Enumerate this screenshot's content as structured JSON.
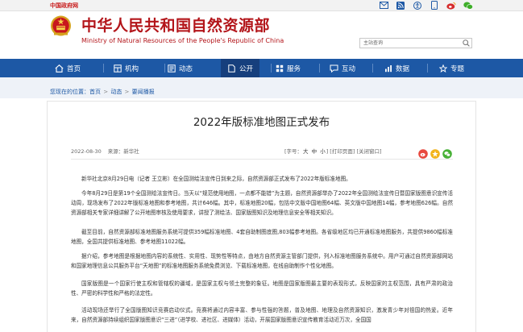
{
  "topbar": {
    "gov_link": "中国政府网"
  },
  "header": {
    "title_cn": "中华人民共和国自然资源部",
    "title_en": "Ministry of Natural Resources of the People's Republic of China",
    "search_placeholder": "主站查询"
  },
  "nav": {
    "items": [
      {
        "label": "首页",
        "icon": "home-icon"
      },
      {
        "label": "机构",
        "icon": "building-icon"
      },
      {
        "label": "动态",
        "icon": "news-icon"
      },
      {
        "label": "公开",
        "icon": "document-icon"
      },
      {
        "label": "服务",
        "icon": "service-icon"
      },
      {
        "label": "互动",
        "icon": "chat-icon"
      },
      {
        "label": "数据",
        "icon": "chart-icon"
      },
      {
        "label": "专题",
        "icon": "topic-icon"
      }
    ]
  },
  "breadcrumb": {
    "prefix": "您现在的位置：",
    "items": [
      "首页",
      "动态",
      "要闻播报"
    ]
  },
  "article": {
    "title": "2022年版标准地图正式发布",
    "date": "2022-08-30",
    "source": "来源：新华社",
    "font_label": "[字号：",
    "font_options": [
      "大",
      "中",
      "小"
    ],
    "print": "] [打印页面]",
    "close": "[关闭窗口]",
    "paragraphs": [
      "新华社北京8月29日电（记者 王立彬）在全国测绘法宣传日到来之际，自然资源部正式发布了2022年版标准地图。",
      "今年8月29日是第19个全国测绘法宣传日。当天以“规范使用地图，一点都不能错”为主题，自然资源部举办了2022年全国测绘法宣传日暨国家版图意识宣传活动周，现场发布了2022年版标准地图和参考地图，共计646幅。其中，标准地图20幅，包括中文版中国地图64幅、英文版中国地图14幅，参考地图626幅。自然资源部相关专家详细讲解了公开地图审核及使用要求，讲授了测绘法、国家版图知识及地理信息安全等相关知识。",
      "截至目前，自然资源部标准地图服务系统可提供359幅标准地图、4套自助制图底图,803幅参考地图。各省级地区均已开通标准地图服务，共提供9860幅标准地图，全国共提供标准地图、参考地图11022幅。",
      "据介绍，参考地图是根据地图内容的系统性、实用性、现势性等特点，由地方自然资源主管部门提供，列入标准地图服务系统中。用户可通过自然资源部网站和国家地理信息公共服务平台“天地图”的标准地图服务系统免费浏览、下载标准地图，在线自助制作个性化地图。",
      "国家版图是一个国家行使主权和管辖权的疆域，是国家主权与领土完整的象征。地图是国家版图最主要的表现形式，反映国家的主权范围，具有严肃的政治性、严密的科学性和严格的法定性。",
      "活动现场还举行了全国版图知识竞赛启动仪式。竞赛将通过内容丰富、参与性强的答题，普及地图、地理及自然资源知识，激发青少年对祖国的热爱。近年来，自然资源部持续组织国家版图意识“三进”（进学校、进社区、进媒体）活动，开展国家版图意识宣传教育活动近万次，全国国"
    ]
  }
}
